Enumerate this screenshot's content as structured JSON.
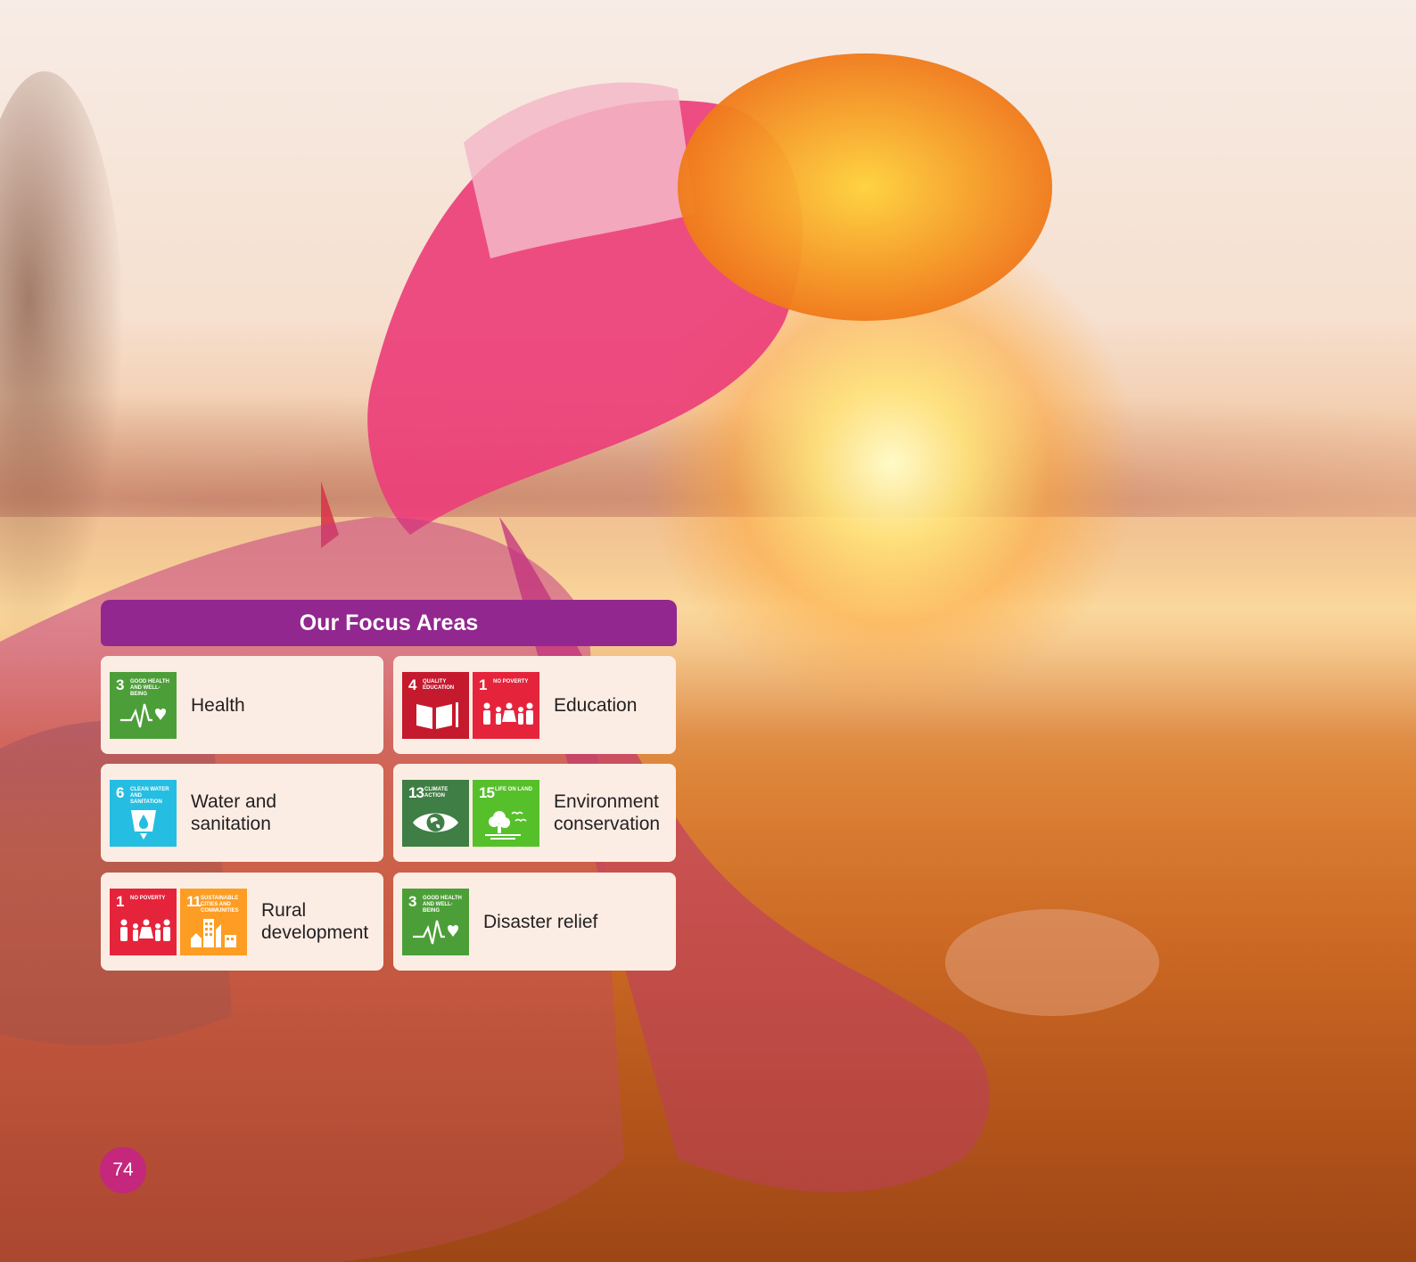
{
  "panel": {
    "title": "Our Focus Areas",
    "header_color": "#92278f"
  },
  "cards": [
    {
      "label": "Health",
      "sdgs": [
        {
          "number": "3",
          "title": "GOOD HEALTH AND WELL-BEING",
          "color": "#4c9f38",
          "icon": "heartbeat-icon"
        }
      ]
    },
    {
      "label": "Education",
      "sdgs": [
        {
          "number": "4",
          "title": "QUALITY EDUCATION",
          "color": "#c5192d",
          "icon": "book-icon"
        },
        {
          "number": "1",
          "title": "NO POVERTY",
          "color": "#e5243b",
          "icon": "family-icon"
        }
      ]
    },
    {
      "label_line1": "Water and",
      "label_line2": "sanitation",
      "sdgs": [
        {
          "number": "6",
          "title": "CLEAN WATER AND SANITATION",
          "color": "#26bde2",
          "icon": "water-glass-icon"
        }
      ]
    },
    {
      "label_line1": "Environment",
      "label_line2": "conservation",
      "sdgs": [
        {
          "number": "13",
          "title": "CLIMATE ACTION",
          "color": "#3f7e44",
          "icon": "eye-globe-icon"
        },
        {
          "number": "15",
          "title": "LIFE ON LAND",
          "color": "#56c02b",
          "icon": "tree-bird-icon"
        }
      ]
    },
    {
      "label_line1": "Rural",
      "label_line2": "development",
      "sdgs": [
        {
          "number": "1",
          "title": "NO POVERTY",
          "color": "#e5243b",
          "icon": "family-icon"
        },
        {
          "number": "11",
          "title": "SUSTAINABLE CITIES AND COMMUNITIES",
          "color": "#fd9d24",
          "icon": "city-icon"
        }
      ]
    },
    {
      "label": "Disaster relief",
      "sdgs": [
        {
          "number": "3",
          "title": "GOOD HEALTH AND WELL-BEING",
          "color": "#4c9f38",
          "icon": "heartbeat-icon"
        }
      ]
    }
  ],
  "page_number": "74",
  "page_number_color": "#c4277b"
}
